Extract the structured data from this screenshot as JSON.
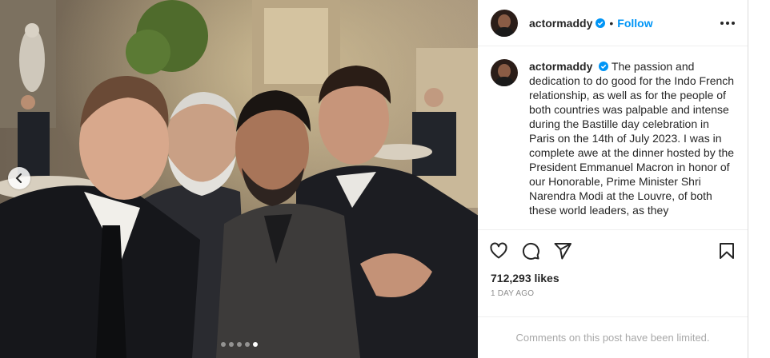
{
  "post": {
    "username": "actormaddy",
    "follow_label": "Follow",
    "separator": "•",
    "caption": "The passion and dedication to do good for the Indo French relationship, as well as for the people of both countries was palpable and intense during the Bastille day celebration in Paris on the 14th of July 2023. I was in complete awe at the dinner hosted by the President Emmanuel Macron in honor of our Honorable, Prime Minister Shri Narendra Modi at the Louvre, of both these world leaders, as they",
    "likes": "712,293 likes",
    "time": "1 DAY AGO",
    "comments_limited": "Comments on this post have been limited.",
    "carousel": {
      "total": 5,
      "active": 5
    }
  },
  "icons": {
    "verified": "verified-badge-icon",
    "like": "heart-icon",
    "comment": "comment-icon",
    "share": "share-icon",
    "save": "bookmark-icon",
    "more": "more-options-icon",
    "prev": "chevron-left-icon"
  },
  "colors": {
    "link": "#0095f6",
    "verified": "#0095f6",
    "muted": "#8e8e8e"
  }
}
